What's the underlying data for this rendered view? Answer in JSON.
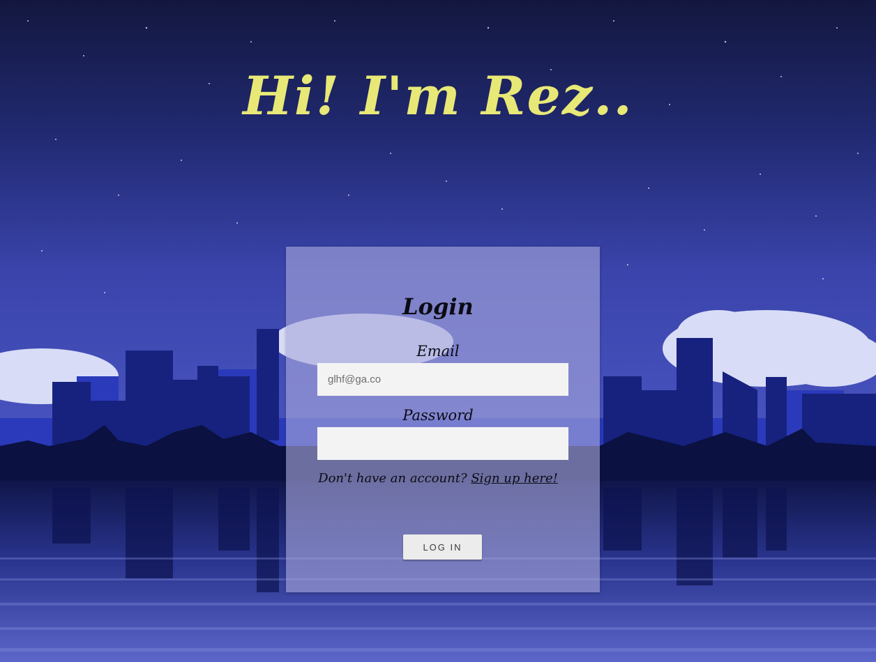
{
  "hero": {
    "title": "Hi! I'm Rez..",
    "color": "#e8e877"
  },
  "login": {
    "heading": "Login",
    "email_label": "Email",
    "email_placeholder": "glhf@ga.co",
    "email_value": "",
    "password_label": "Password",
    "password_value": "",
    "signup_prompt": "Don't have an account? ",
    "signup_link": "Sign up here!",
    "submit_label": "LOG IN"
  },
  "theme": {
    "sky_top": "#13173f",
    "sky_bottom": "#3b45b2",
    "panel": "#a8a8dc",
    "accent_yellow": "#e8e877"
  }
}
